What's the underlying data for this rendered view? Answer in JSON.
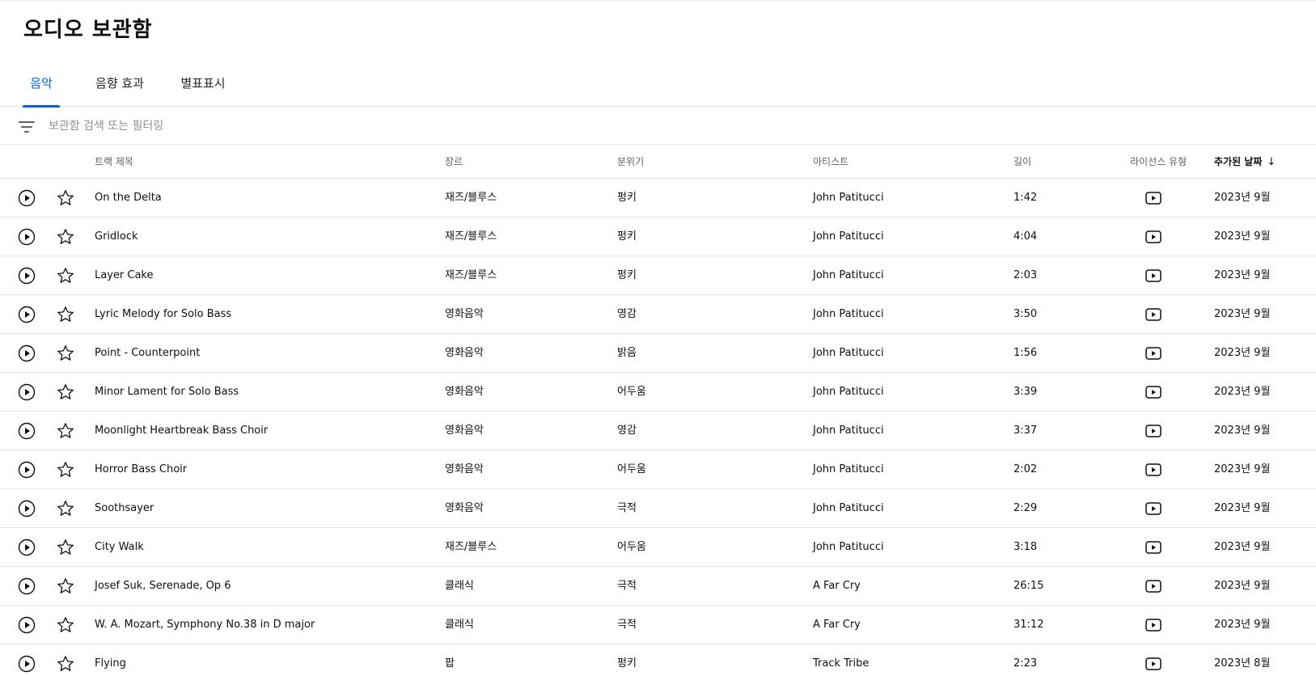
{
  "page": {
    "title": "오디오 보관함"
  },
  "tabs": [
    {
      "label": "음악",
      "active": true
    },
    {
      "label": "음향 효과",
      "active": false
    },
    {
      "label": "별표표시",
      "active": false
    }
  ],
  "search": {
    "placeholder": "보관함 검색 또는 필터링",
    "value": ""
  },
  "table": {
    "columns": {
      "track_title": "트랙 제목",
      "genre": "장르",
      "mood": "분위기",
      "artist": "아티스트",
      "duration": "길이",
      "license": "라이선스 유형",
      "date_added": "추가된 날짜"
    },
    "sorted_by": "date_added",
    "sort_direction": "descending",
    "rows": [
      {
        "title": "On the Delta",
        "genre": "재즈/블루스",
        "mood": "펑키",
        "artist": "John Patitucci",
        "duration": "1:42",
        "license_icon": "youtube-license-icon",
        "date": "2023년 9월"
      },
      {
        "title": "Gridlock",
        "genre": "재즈/블루스",
        "mood": "펑키",
        "artist": "John Patitucci",
        "duration": "4:04",
        "license_icon": "youtube-license-icon",
        "date": "2023년 9월"
      },
      {
        "title": "Layer Cake",
        "genre": "재즈/블루스",
        "mood": "펑키",
        "artist": "John Patitucci",
        "duration": "2:03",
        "license_icon": "youtube-license-icon",
        "date": "2023년 9월"
      },
      {
        "title": "Lyric Melody for Solo Bass",
        "genre": "영화음악",
        "mood": "영감",
        "artist": "John Patitucci",
        "duration": "3:50",
        "license_icon": "youtube-license-icon",
        "date": "2023년 9월"
      },
      {
        "title": "Point - Counterpoint",
        "genre": "영화음악",
        "mood": "밝음",
        "artist": "John Patitucci",
        "duration": "1:56",
        "license_icon": "youtube-license-icon",
        "date": "2023년 9월"
      },
      {
        "title": "Minor Lament for Solo Bass",
        "genre": "영화음악",
        "mood": "어두움",
        "artist": "John Patitucci",
        "duration": "3:39",
        "license_icon": "youtube-license-icon",
        "date": "2023년 9월"
      },
      {
        "title": "Moonlight Heartbreak Bass Choir",
        "genre": "영화음악",
        "mood": "영감",
        "artist": "John Patitucci",
        "duration": "3:37",
        "license_icon": "youtube-license-icon",
        "date": "2023년 9월"
      },
      {
        "title": "Horror Bass Choir",
        "genre": "영화음악",
        "mood": "어두움",
        "artist": "John Patitucci",
        "duration": "2:02",
        "license_icon": "youtube-license-icon",
        "date": "2023년 9월"
      },
      {
        "title": "Soothsayer",
        "genre": "영화음악",
        "mood": "극적",
        "artist": "John Patitucci",
        "duration": "2:29",
        "license_icon": "youtube-license-icon",
        "date": "2023년 9월"
      },
      {
        "title": "City Walk",
        "genre": "재즈/블루스",
        "mood": "어두움",
        "artist": "John Patitucci",
        "duration": "3:18",
        "license_icon": "youtube-license-icon",
        "date": "2023년 9월"
      },
      {
        "title": "Josef Suk, Serenade, Op 6",
        "genre": "클래식",
        "mood": "극적",
        "artist": "A Far Cry",
        "duration": "26:15",
        "license_icon": "youtube-license-icon",
        "date": "2023년 9월"
      },
      {
        "title": "W. A. Mozart, Symphony No.38 in D major",
        "genre": "클래식",
        "mood": "극적",
        "artist": "A Far Cry",
        "duration": "31:12",
        "license_icon": "youtube-license-icon",
        "date": "2023년 9월"
      },
      {
        "title": "Flying",
        "genre": "팝",
        "mood": "펑키",
        "artist": "Track Tribe",
        "duration": "2:23",
        "license_icon": "youtube-license-icon",
        "date": "2023년 8월"
      }
    ]
  },
  "colors": {
    "accent": "#065fd4",
    "text": "#0f0f0f",
    "secondary_text": "#606060",
    "divider": "#e5e5e5"
  }
}
